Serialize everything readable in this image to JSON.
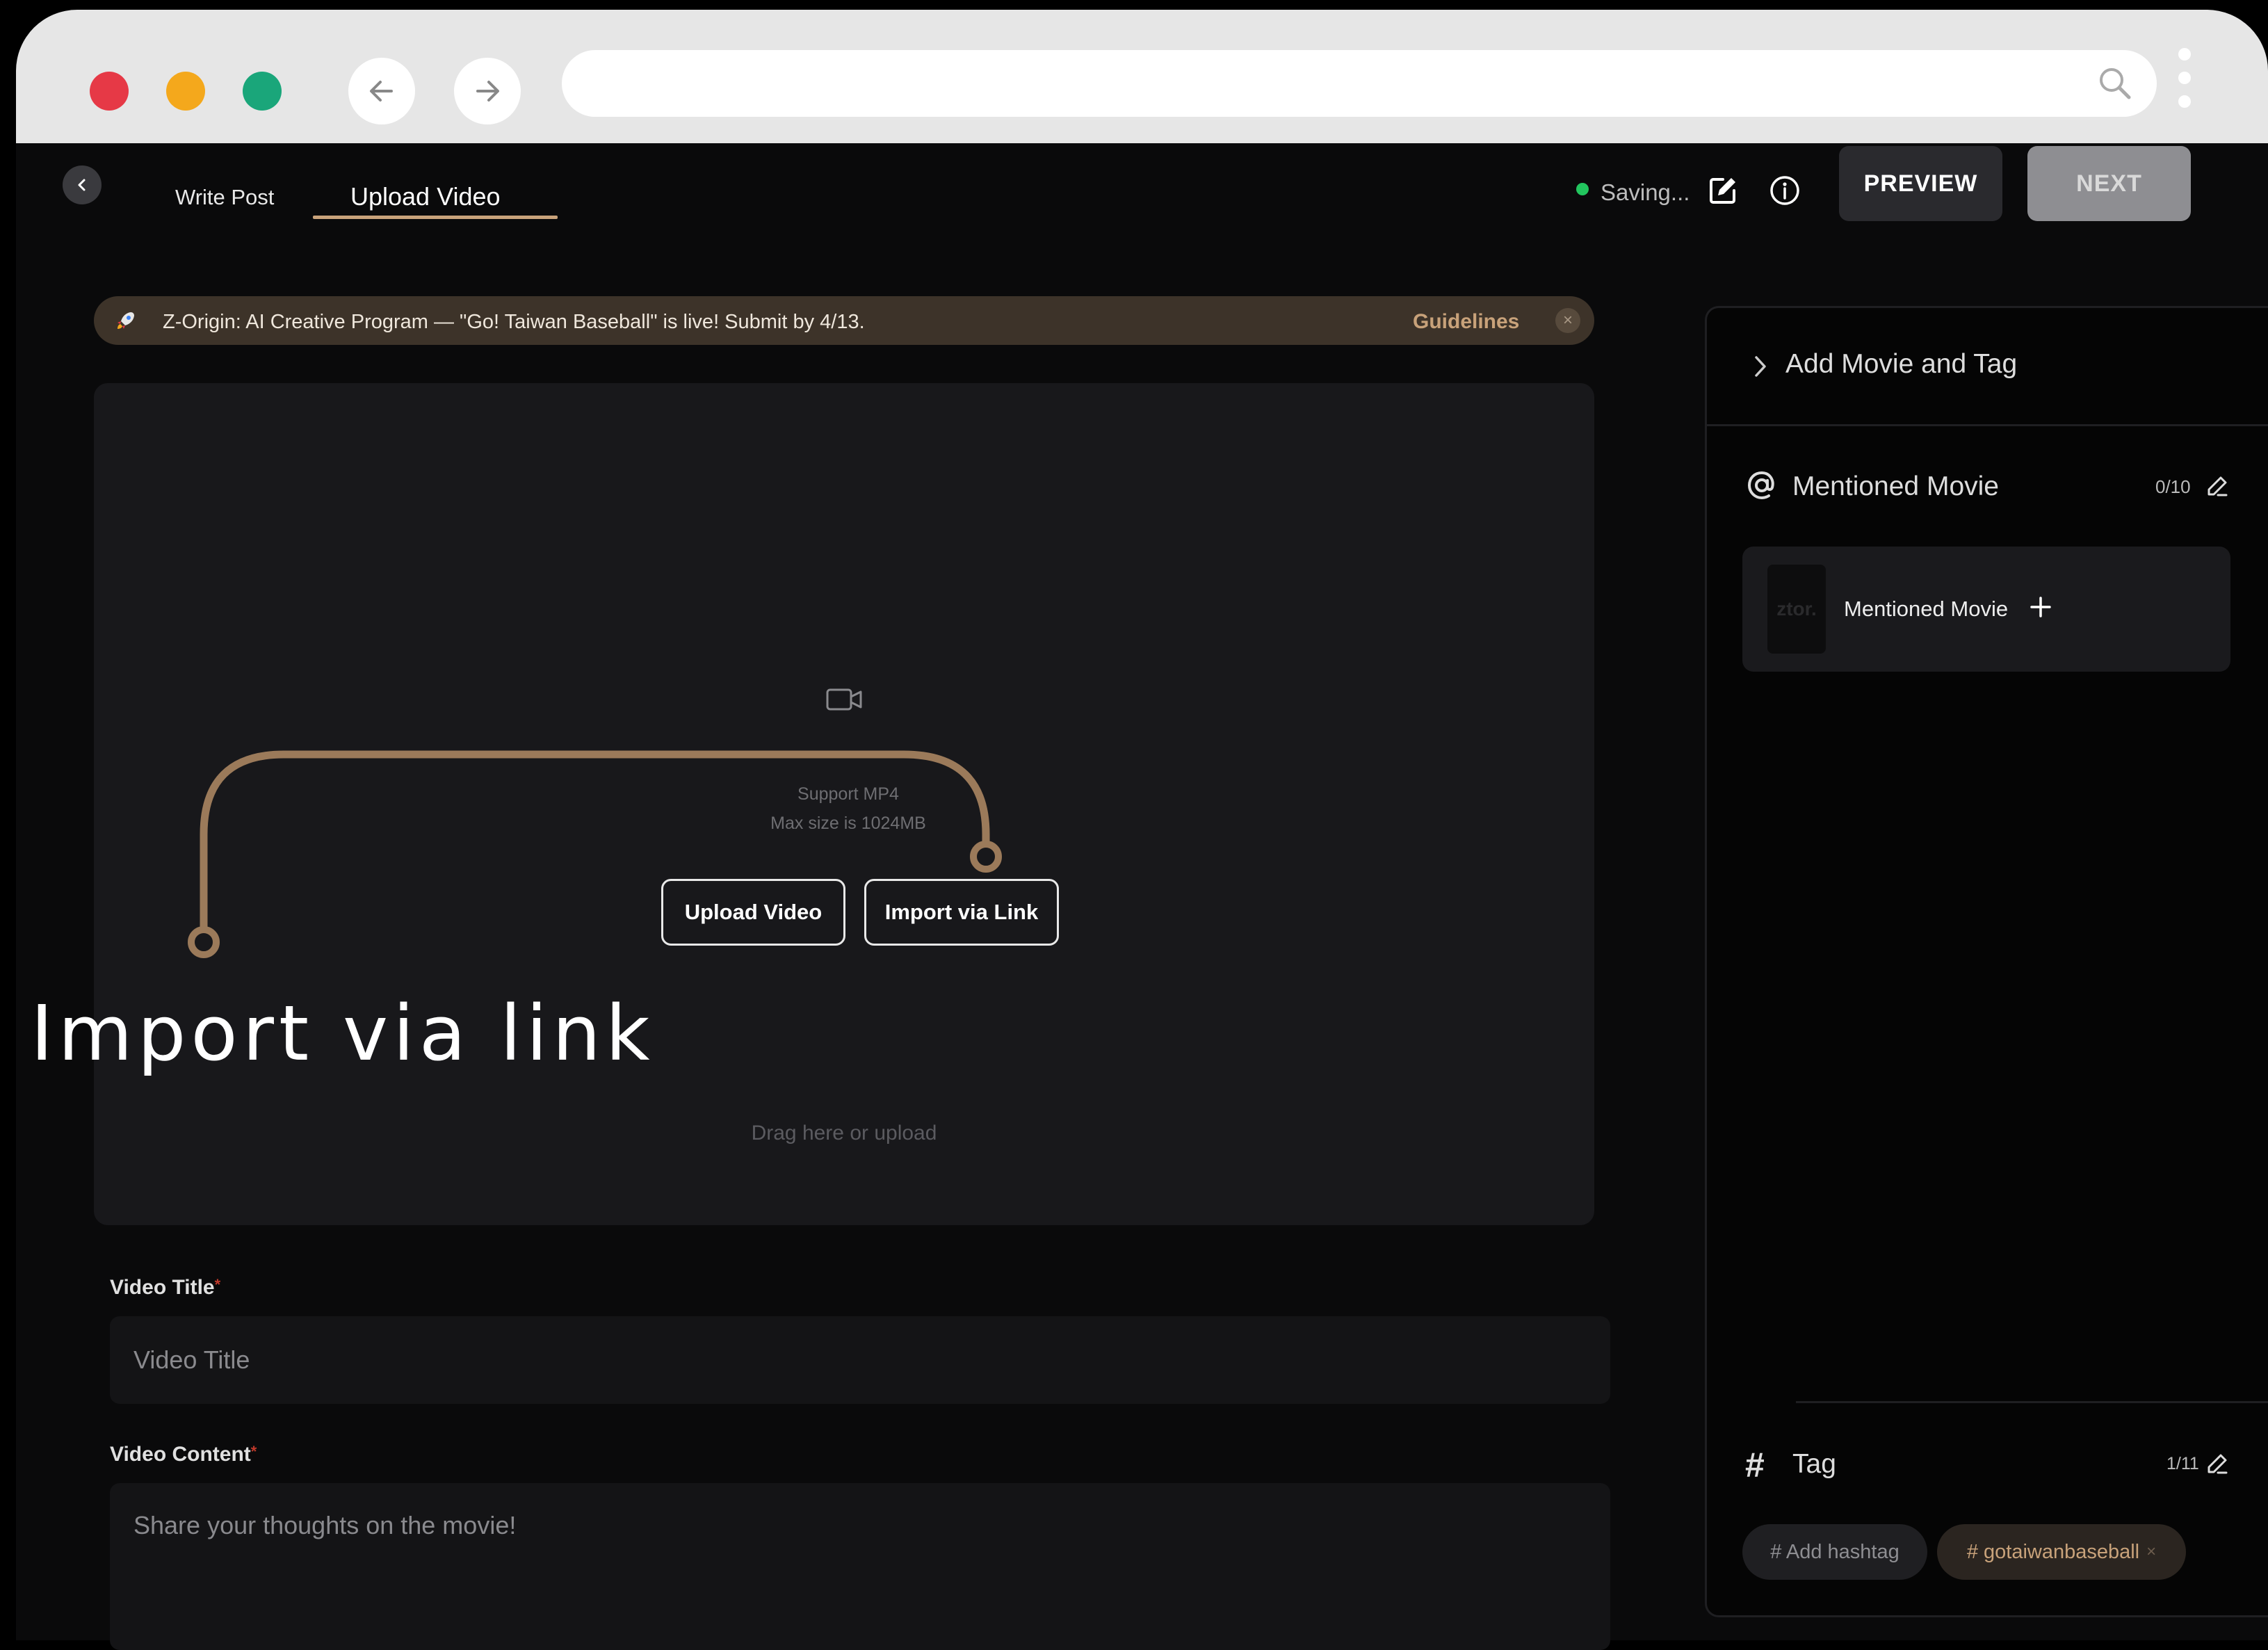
{
  "browser": {
    "controls": [
      "close-dot",
      "minimize-dot",
      "maximize-dot"
    ],
    "colors": {
      "close": "#e63946",
      "minimize": "#f4a81c",
      "maximize": "#1aa67a"
    },
    "url": "",
    "icons": [
      "back-arrow-icon",
      "forward-arrow-icon",
      "search-icon",
      "kebab-menu-icon"
    ]
  },
  "header": {
    "tabs": [
      {
        "label": "Write Post",
        "active": false
      },
      {
        "label": "Upload Video",
        "active": true
      }
    ],
    "status": "Saving...",
    "preview_label": "PREVIEW",
    "next_label": "NEXT",
    "accent_color": "#c8a27a"
  },
  "announcement": {
    "icon": "rocket-icon",
    "text": "Z-Origin: AI Creative Program — \"Go! Taiwan Baseball\" is live! Submit by 4/13.",
    "link_label": "Guidelines",
    "close_glyph": "×"
  },
  "upload": {
    "icon": "video-camera-icon",
    "drag_text": "Drag here or upload",
    "support_text": "Support MP4",
    "max_size_text": "Max size is 1024MB",
    "upload_button": "Upload Video",
    "import_button": "Import via Link"
  },
  "callout": {
    "label": "Import via link"
  },
  "form": {
    "title_label": "Video Title",
    "title_placeholder": "Video Title",
    "content_label": "Video Content",
    "content_placeholder": "Share your thoughts on the movie!",
    "required_mark": "*"
  },
  "sidebar": {
    "add_section_label": "Add Movie and Tag",
    "mentioned": {
      "title": "Mentioned Movie",
      "count": "0/10",
      "card_label": "Mentioned Movie",
      "thumb_text": "ztor."
    },
    "tags": {
      "title": "Tag",
      "count": "1/11",
      "add_label": "# Add hashtag",
      "items": [
        "# gotaiwanbaseball"
      ],
      "remove_glyph": "×"
    }
  }
}
